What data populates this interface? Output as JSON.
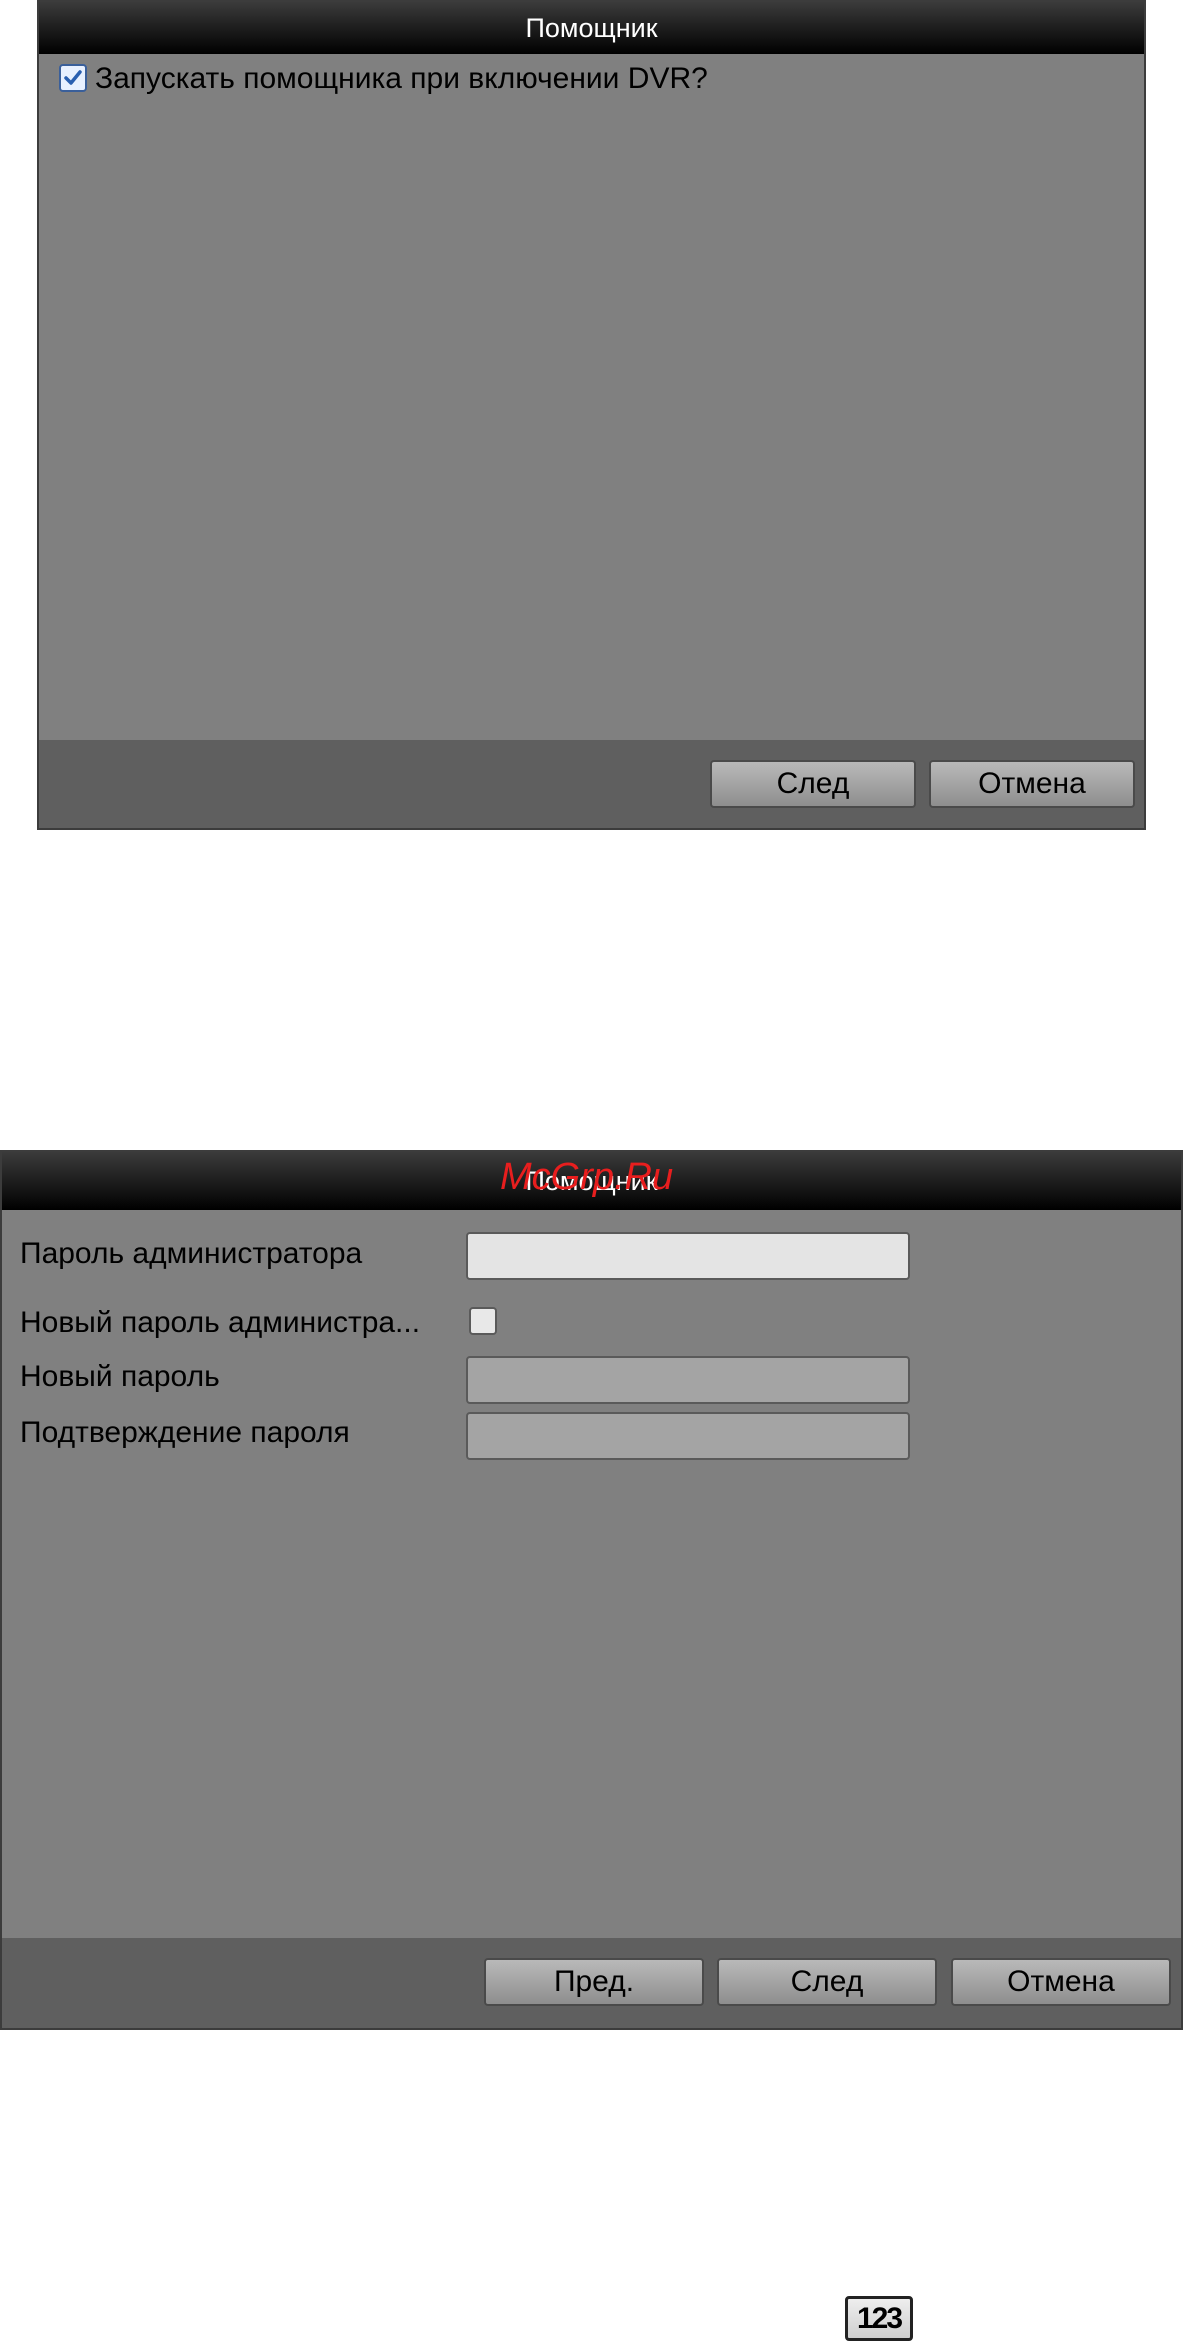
{
  "dialog1": {
    "title": "Помощник",
    "checkbox_label": "Запускать помощника при включении DVR?",
    "checkbox_checked": true,
    "buttons": {
      "next": "След",
      "cancel": "Отмена"
    }
  },
  "dialog2": {
    "title": "Помощник",
    "watermark": "McGrp.Ru",
    "fields": {
      "admin_password_label": "Пароль администратора",
      "admin_password_value": "",
      "new_admin_password_label": "Новый пароль администра...",
      "new_admin_password_checked": false,
      "new_password_label": "Новый пароль",
      "new_password_value": "",
      "confirm_password_label": "Подтверждение пароля",
      "confirm_password_value": ""
    },
    "buttons": {
      "prev": "Пред.",
      "next": "След",
      "cancel": "Отмена"
    }
  },
  "keyboard_icon": {
    "label": "123",
    "icon": "numeric-keypad-icon"
  }
}
